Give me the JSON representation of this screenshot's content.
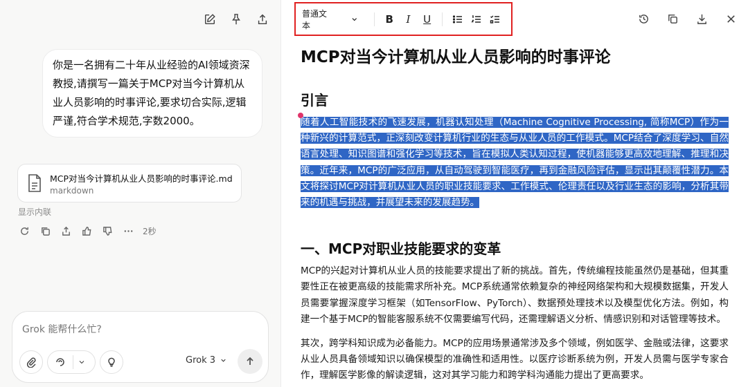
{
  "chat": {
    "user_message": "你是一名拥有二十年从业经验的AI领域资深教授,请撰写一篇关于MCP对当今计算机从业人员影响的时事评论,要求切合实际,逻辑严谨,符合学术规范,字数2000。",
    "file_name": "MCP对当今计算机从业人员影响的时事评论.md",
    "file_type": "markdown",
    "show_content": "显示内联",
    "response_time": "2秒",
    "composer_placeholder": "Grok 能帮什么忙?",
    "model_label": "Grok 3"
  },
  "toolbar": {
    "text_style": "普通文本",
    "bold": "B",
    "italic": "I",
    "underline": "U"
  },
  "document": {
    "title": "MCP对当今计算机从业人员影响的时事评论",
    "intro_heading": "引言",
    "intro_text": "随着人工智能技术的飞速发展，机器认知处理（Machine Cognitive Processing, 简称MCP）作为一种新兴的计算范式，正深刻改变计算机行业的生态与从业人员的工作模式。MCP结合了深度学习、自然语言处理、知识图谱和强化学习等技术，旨在模拟人类认知过程，使机器能够更高效地理解、推理和决策。近年来，MCP的广泛应用，从自动驾驶到智能医疗，再到金融风险评估，显示出其颠覆性潜力。本文将探讨MCP对计算机从业人员的职业技能要求、工作模式、伦理责任以及行业生态的影响，分析其带来的机遇与挑战，并展望未来的发展趋势。",
    "section1_heading": "一、MCP对职业技能要求的变革",
    "section1_p1": "MCP的兴起对计算机从业人员的技能要求提出了新的挑战。首先，传统编程技能虽然仍是基础，但其重要性正在被更高级的技能需求所补充。MCP系统通常依赖复杂的神经网络架构和大规模数据集，开发人员需要掌握深度学习框架（如TensorFlow、PyTorch）、数据预处理技术以及模型优化方法。例如，构建一个基于MCP的智能客服系统不仅需要编写代码，还需理解语义分析、情感识别和对话管理等技术。",
    "section1_p2": "其次，跨学科知识成为必备能力。MCP的应用场景通常涉及多个领域，例如医学、金融或法律，这要求从业人员具备领域知识以确保模型的准确性和适用性。以医疗诊断系统为例，开发人员需与医学专家合作，理解医学影像的解读逻辑，这对其学习能力和跨学科沟通能力提出了更高要求。"
  },
  "colors": {
    "selection": "#2f66c5",
    "highlight_box": "#e02020"
  }
}
